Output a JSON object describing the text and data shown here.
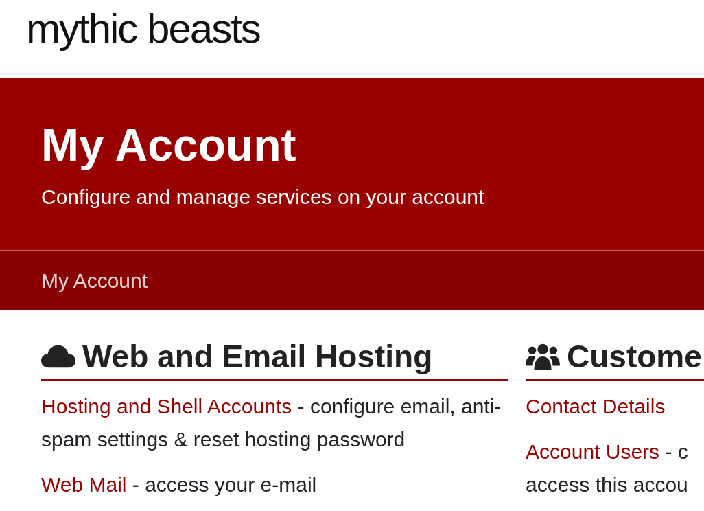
{
  "logo": {
    "text": "mythic beasts"
  },
  "banner": {
    "title": "My Account",
    "subtitle": "Configure and manage services on your account"
  },
  "breadcrumb": [
    {
      "label": "My Account"
    }
  ],
  "sections": [
    {
      "kind": "cloud",
      "title": "Web and Email Hosting",
      "items": [
        {
          "link": "Hosting and Shell Accounts",
          "description": " - configure email, anti-spam settings & reset hosting password"
        },
        {
          "link": "Web Mail",
          "description": " - access your e-mail"
        }
      ]
    },
    {
      "kind": "users",
      "title": "Custome",
      "items": [
        {
          "link": "Contact Details"
        },
        {
          "link": "Account Users",
          "description": " - c\naccess this accou"
        }
      ]
    }
  ]
}
